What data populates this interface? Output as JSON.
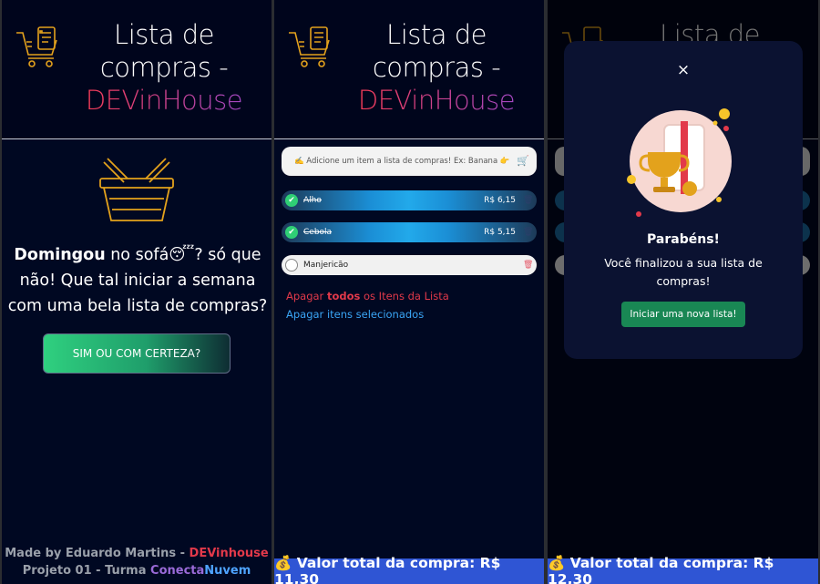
{
  "app": {
    "title_line1": "Lista de",
    "title_line2": "compras -",
    "brand": "DEVinHouse"
  },
  "screen1": {
    "greeting_bold": "Domingou",
    "greeting_rest": " no sofá😴? só que não! Que tal iniciar a semana com uma bela lista de compras?",
    "cta_label": "SIM OU COM CERTEZA?",
    "credit_line1_prefix": "Made by Eduardo Martins - ",
    "credit_line1_brand": "DEVinhouse",
    "credit_line2_prefix": "Projeto 01 - Turma ",
    "credit_line2_conecta": "Conecta",
    "credit_line2_nuvem": "Nuvem"
  },
  "screen2": {
    "search_placeholder": "✍️ Adicione um item a lista de compras! Ex: Banana 👉",
    "items": [
      {
        "name": "Alho",
        "price": "R$ 6,15",
        "checked": true
      },
      {
        "name": "Cebola",
        "price": "R$ 5,15",
        "checked": true
      },
      {
        "name": "Manjericão",
        "price": "",
        "checked": false
      }
    ],
    "delete_all_prefix": "Apagar ",
    "delete_all_bold": "todos",
    "delete_all_suffix": " os Itens da Lista",
    "delete_selected": "Apagar itens selecionados",
    "total": "💰 Valor total da compra: R$ 11,30"
  },
  "screen3": {
    "total": "💰 Valor total da compra: R$ 12,30",
    "modal": {
      "close": "×",
      "title": "Parabéns!",
      "body": "Você finalizou a sua lista de compras!",
      "button": "Iniciar uma nova lista!"
    }
  },
  "colors": {
    "background": "#000822",
    "accent_red": "#e2394a",
    "accent_blue": "#3aa5f5",
    "total_bar": "#2f55d4",
    "success": "#198754"
  }
}
